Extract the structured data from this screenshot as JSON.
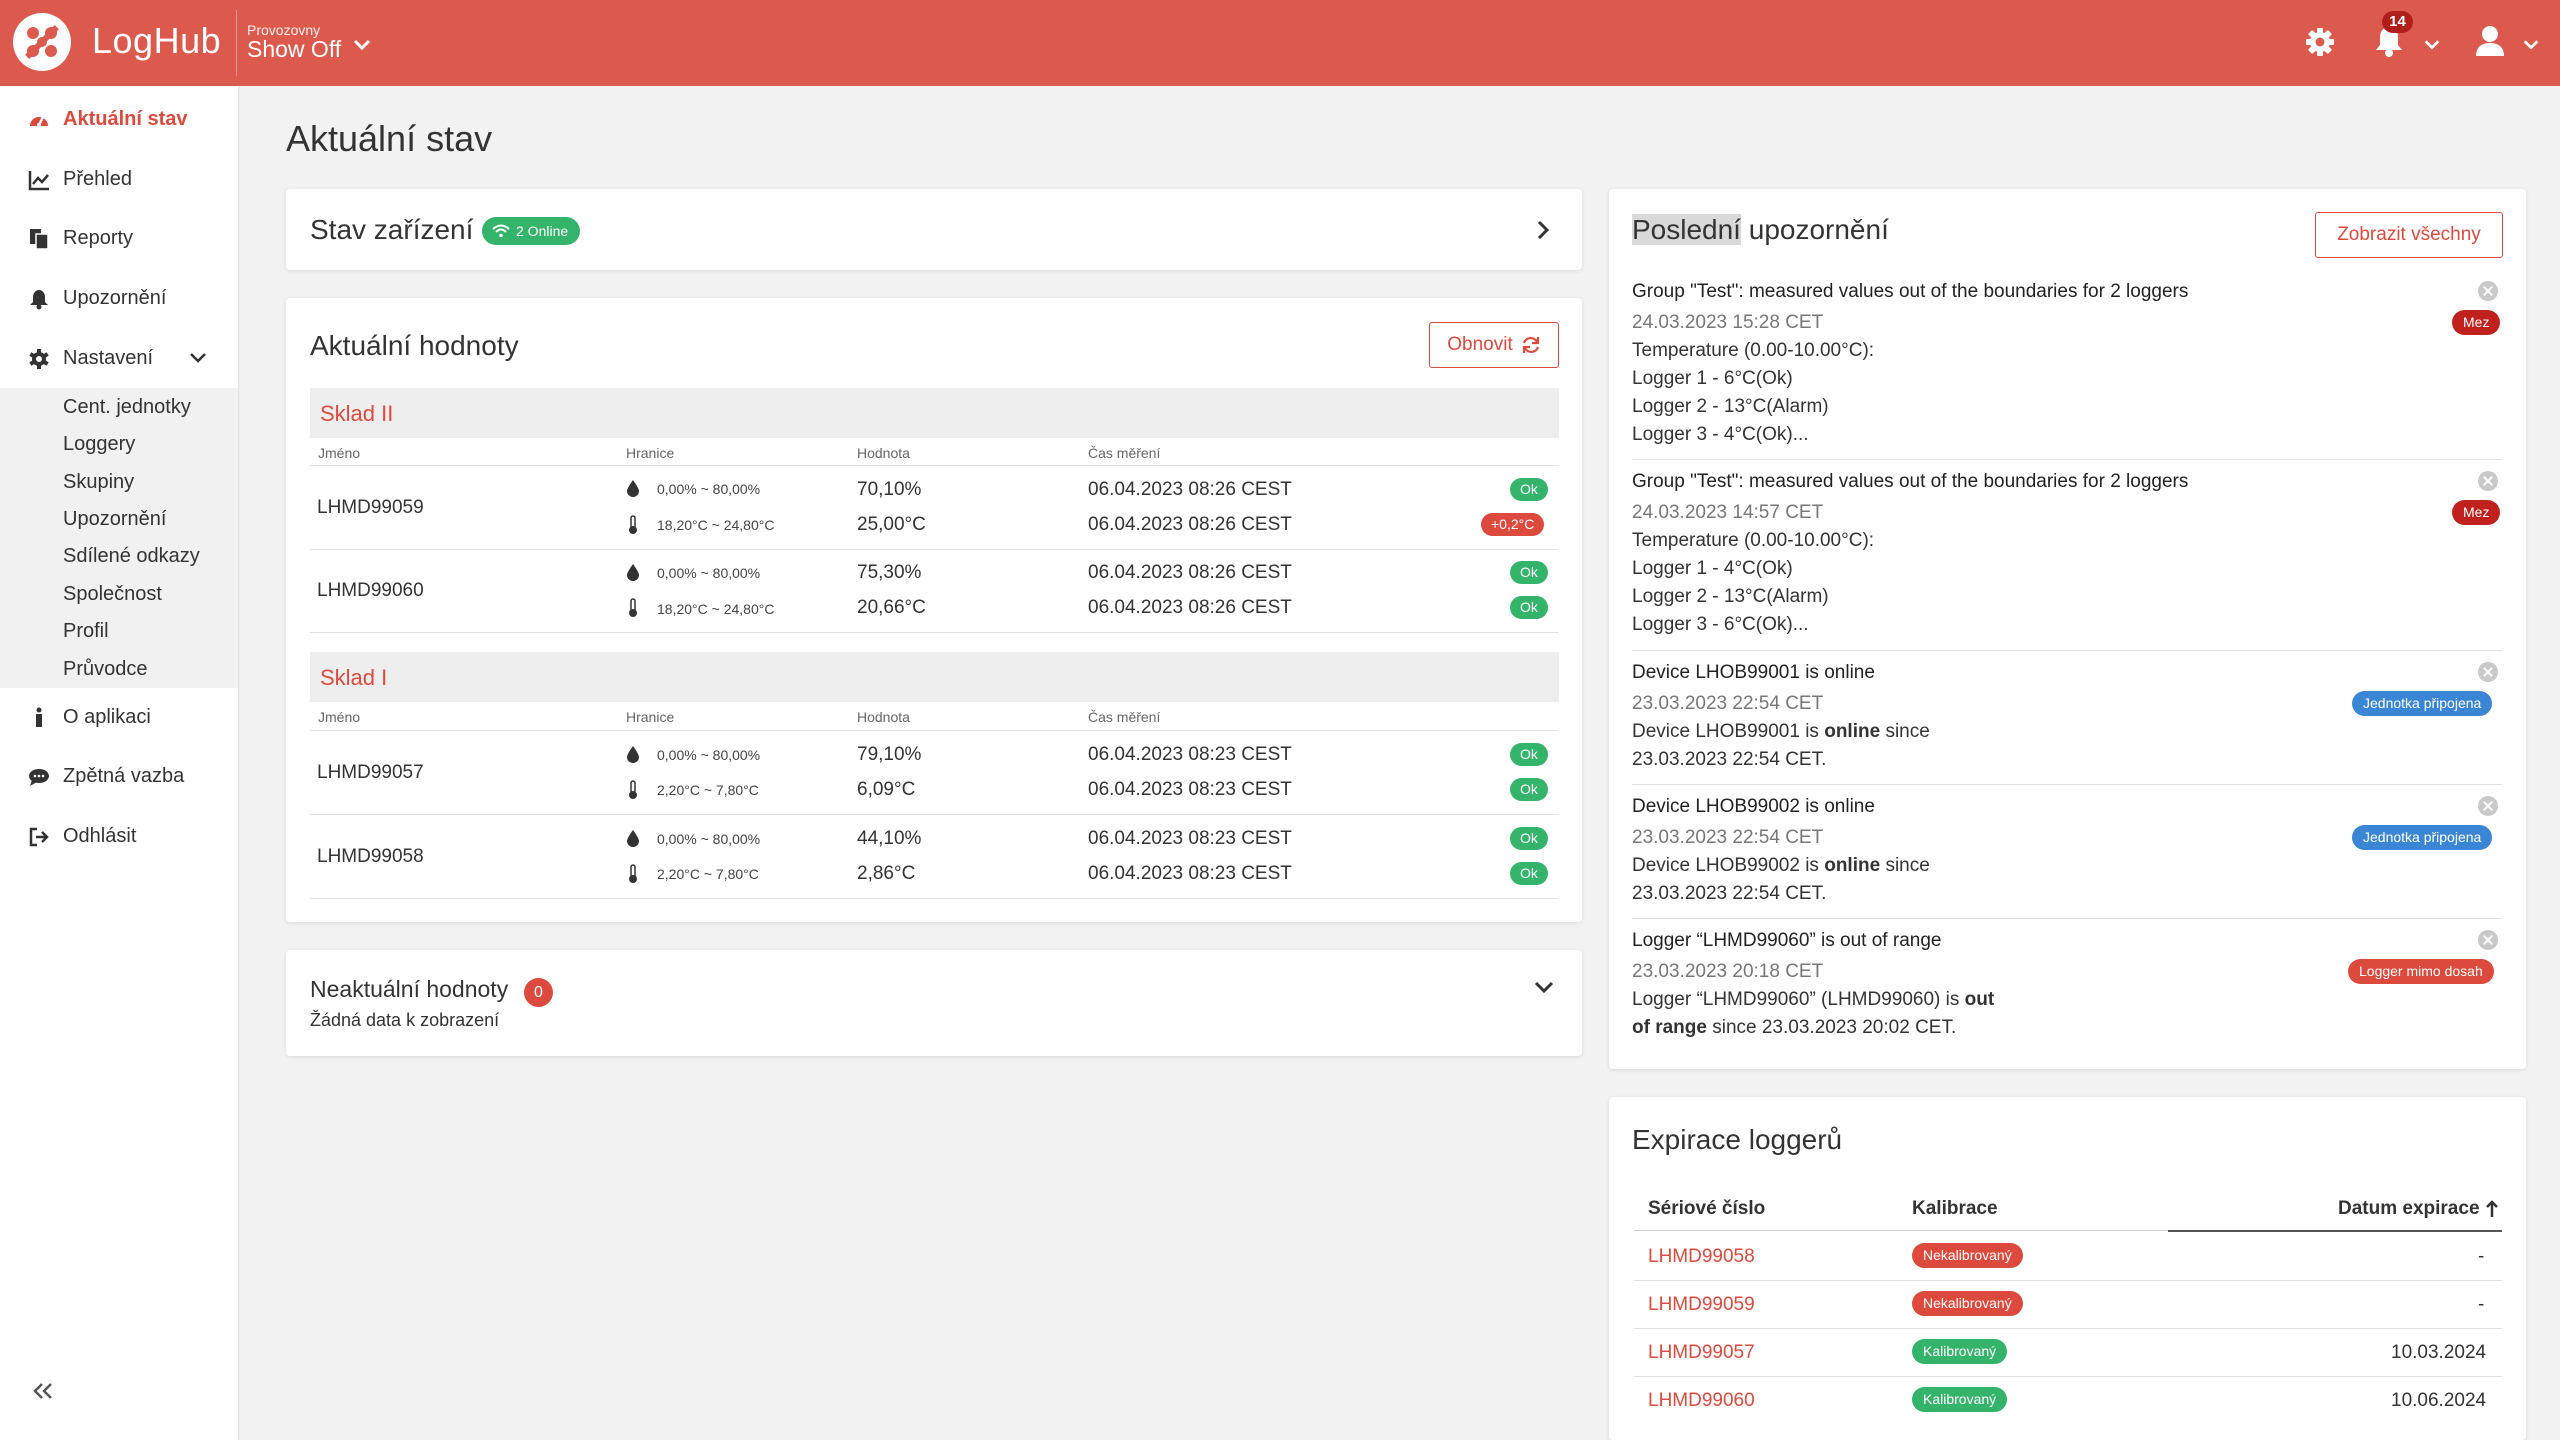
{
  "topbar": {
    "brand": "LogHub",
    "workspace_label": "Provozovny",
    "workspace_value": "Show Off",
    "notification_count": "14"
  },
  "sidebar": {
    "items": [
      {
        "label": "Aktuální stav",
        "icon": "dashboard-icon",
        "active": true
      },
      {
        "label": "Přehled",
        "icon": "chart-line-icon"
      },
      {
        "label": "Reporty",
        "icon": "files-icon"
      },
      {
        "label": "Upozornění",
        "icon": "bell-icon"
      },
      {
        "label": "Nastavení",
        "icon": "gear-icon"
      },
      {
        "label": "O aplikaci",
        "icon": "info-icon"
      },
      {
        "label": "Zpětná vazba",
        "icon": "comment-icon"
      },
      {
        "label": "Odhlásit",
        "icon": "sign-out-icon"
      }
    ],
    "submenu": [
      "Cent. jednotky",
      "Loggery",
      "Skupiny",
      "Upozornění",
      "Sdílené odkazy",
      "Společnost",
      "Profil",
      "Průvodce"
    ]
  },
  "page": {
    "title": "Aktuální stav"
  },
  "devices": {
    "title": "Stav zařízení",
    "online_badge": "2 Online"
  },
  "current": {
    "title": "Aktuální hodnoty",
    "refresh_label": "Obnovit",
    "columns": [
      "Jméno",
      "Hranice",
      "Hodnota",
      "Čas měření"
    ],
    "groups": [
      {
        "name": "Sklad II",
        "loggers": [
          {
            "name": "LHMD99059",
            "rows": [
              {
                "range": "0,00% ~ 80,00%",
                "value": "70,10%",
                "time": "06.04.2023 08:26 CEST",
                "status": "Ok"
              },
              {
                "range": "18,20°C ~ 24,80°C",
                "value": "25,00°C",
                "time": "06.04.2023 08:26 CEST",
                "status": "+0,2°C"
              }
            ]
          },
          {
            "name": "LHMD99060",
            "rows": [
              {
                "range": "0,00% ~ 80,00%",
                "value": "75,30%",
                "time": "06.04.2023 08:26 CEST",
                "status": "Ok"
              },
              {
                "range": "18,20°C ~ 24,80°C",
                "value": "20,66°C",
                "time": "06.04.2023 08:26 CEST",
                "status": "Ok"
              }
            ]
          }
        ]
      },
      {
        "name": "Sklad I",
        "loggers": [
          {
            "name": "LHMD99057",
            "rows": [
              {
                "range": "0,00% ~ 80,00%",
                "value": "79,10%",
                "time": "06.04.2023 08:23 CEST",
                "status": "Ok"
              },
              {
                "range": "2,20°C ~ 7,80°C",
                "value": "6,09°C",
                "time": "06.04.2023 08:23 CEST",
                "status": "Ok"
              }
            ]
          },
          {
            "name": "LHMD99058",
            "rows": [
              {
                "range": "0,00% ~ 80,00%",
                "value": "44,10%",
                "time": "06.04.2023 08:23 CEST",
                "status": "Ok"
              },
              {
                "range": "2,20°C ~ 7,80°C",
                "value": "2,86°C",
                "time": "06.04.2023 08:23 CEST",
                "status": "Ok"
              }
            ]
          }
        ]
      }
    ]
  },
  "stale": {
    "title": "Neaktuální hodnoty",
    "count": "0",
    "empty_text": "Žádná data k zobrazení"
  },
  "notifications": {
    "title_highlight": "Poslední",
    "title_rest": " upozornění",
    "show_all": "Zobrazit všechny",
    "items": [
      {
        "head": "Group \"Test\": measured values out of the boundaries for 2 loggers",
        "date": "24.03.2023 15:28 CET",
        "lines": [
          "Temperature (0.00-10.00°C):",
          "Logger 1 - 6°C(Ok)",
          "Logger 2 - 13°C(Alarm)",
          "Logger 3 - 4°C(Ok)..."
        ],
        "tag": "Mez"
      },
      {
        "head": "Group \"Test\": measured values out of the boundaries for 2 loggers",
        "date": "24.03.2023 14:57 CET",
        "lines": [
          "Temperature (0.00-10.00°C):",
          "Logger 1 - 4°C(Ok)",
          "Logger 2 - 13°C(Alarm)",
          "Logger 3 - 6°C(Ok)..."
        ],
        "tag": "Mez"
      },
      {
        "head": "Device LHOB99001 is online",
        "date": "23.03.2023 22:54 CET",
        "body_pre": "Device LHOB99001 is ",
        "body_bold": "online",
        "body_post": " since",
        "body_line2": "23.03.2023 22:54 CET.",
        "tag": "Jednotka připojena"
      },
      {
        "head": "Device LHOB99002 is online",
        "date": "23.03.2023 22:54 CET",
        "body_pre": "Device LHOB99002 is ",
        "body_bold": "online",
        "body_post": " since",
        "body_line2": "23.03.2023 22:54 CET.",
        "tag": "Jednotka připojena"
      },
      {
        "head": "Logger “LHMD99060” is out of range",
        "date": "23.03.2023 20:18 CET",
        "body_pre": "Logger “LHMD99060” (LHMD99060) is ",
        "body_bold": "out",
        "body_bold2": "of range",
        "body_post": " since 23.03.2023 20:02 CET.",
        "tag": "Logger mimo dosah"
      }
    ]
  },
  "expiry": {
    "title": "Expirace loggerů",
    "columns": [
      "Sériové číslo",
      "Kalibrace",
      "Datum expirace"
    ],
    "rows": [
      {
        "serial": "LHMD99058",
        "calibration": "Nekalibrovaný",
        "date": "-"
      },
      {
        "serial": "LHMD99059",
        "calibration": "Nekalibrovaný",
        "date": "-"
      },
      {
        "serial": "LHMD99057",
        "calibration": "Kalibrovaný",
        "date": "10.03.2024"
      },
      {
        "serial": "LHMD99060",
        "calibration": "Kalibrovaný",
        "date": "10.06.2024"
      }
    ]
  },
  "colors": {
    "brand": "#dc5a4d",
    "accent": "#dc4a3d",
    "ok": "#34b36b",
    "info": "#3a86d4",
    "alarm": "#c0211d"
  }
}
